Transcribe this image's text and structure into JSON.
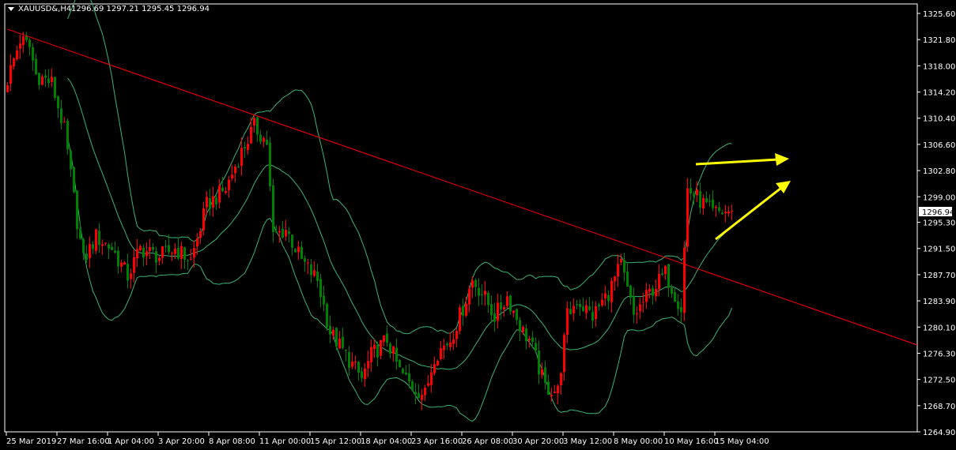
{
  "header": {
    "symbol": "XAUUSD&,H4",
    "ohlc": "1296.69 1297.21 1295.45 1296.94"
  },
  "colors": {
    "background": "#000000",
    "bull_candle": "#ff0000",
    "bear_candle": "#008000",
    "bands": "#3cb371",
    "trendline": "#ff0000",
    "arrows": "#ffff00",
    "axis": "#ffffff"
  },
  "chart_data": {
    "type": "candlestick",
    "title": "XAUUSD&,H4",
    "current_price": "1296.94",
    "ylim": [
      1264.9,
      1325.6
    ],
    "y_ticks": [
      "1325.60",
      "1321.80",
      "1318.00",
      "1314.20",
      "1310.40",
      "1306.60",
      "1302.80",
      "1299.00",
      "1295.30",
      "1291.50",
      "1287.70",
      "1283.90",
      "1280.10",
      "1276.30",
      "1272.50",
      "1268.70",
      "1264.90"
    ],
    "x_ticks": [
      {
        "bar": 0,
        "label": "25 Mar 2019"
      },
      {
        "bar": 16,
        "label": "27 Mar 16:00"
      },
      {
        "bar": 32,
        "label": "1 Apr 04:00"
      },
      {
        "bar": 48,
        "label": "3 Apr 20:00"
      },
      {
        "bar": 64,
        "label": "8 Apr 08:00"
      },
      {
        "bar": 80,
        "label": "11 Apr 00:00"
      },
      {
        "bar": 96,
        "label": "15 Apr 12:00"
      },
      {
        "bar": 112,
        "label": "18 Apr 04:00"
      },
      {
        "bar": 128,
        "label": "23 Apr 16:00"
      },
      {
        "bar": 144,
        "label": "26 Apr 08:00"
      },
      {
        "bar": 160,
        "label": "30 Apr 20:00"
      },
      {
        "bar": 176,
        "label": "3 May 12:00"
      },
      {
        "bar": 192,
        "label": "8 May 00:00"
      },
      {
        "bar": 208,
        "label": "10 May 16:00"
      },
      {
        "bar": 224,
        "label": "15 May 04:00"
      }
    ],
    "total_bars_visible": 288,
    "close_path": [
      [
        0,
        1316.0
      ],
      [
        4,
        1321.8
      ],
      [
        7,
        1320.7
      ],
      [
        9,
        1316.7
      ],
      [
        14,
        1315.5
      ],
      [
        18,
        1308.6
      ],
      [
        22,
        1295.5
      ],
      [
        24,
        1289.7
      ],
      [
        28,
        1293.2
      ],
      [
        33,
        1291.5
      ],
      [
        38,
        1287.5
      ],
      [
        42,
        1291.5
      ],
      [
        48,
        1290.3
      ],
      [
        53,
        1291.5
      ],
      [
        58,
        1289.7
      ],
      [
        63,
        1297.8
      ],
      [
        69,
        1300.1
      ],
      [
        73,
        1304.6
      ],
      [
        78,
        1309.2
      ],
      [
        82,
        1306.9
      ],
      [
        84,
        1293.2
      ],
      [
        88,
        1294.3
      ],
      [
        93,
        1289.7
      ],
      [
        98,
        1286.9
      ],
      [
        102,
        1279.4
      ],
      [
        107,
        1276.0
      ],
      [
        112,
        1272.6
      ],
      [
        115,
        1276.0
      ],
      [
        120,
        1278.3
      ],
      [
        124,
        1273.7
      ],
      [
        128,
        1271.4
      ],
      [
        132,
        1270.3
      ],
      [
        135,
        1276.0
      ],
      [
        140,
        1278.3
      ],
      [
        144,
        1282.9
      ],
      [
        147,
        1286.9
      ],
      [
        150,
        1285.1
      ],
      [
        154,
        1281.7
      ],
      [
        158,
        1284.5
      ],
      [
        163,
        1279.4
      ],
      [
        165,
        1278.3
      ],
      [
        170,
        1271.4
      ],
      [
        174,
        1270.8
      ],
      [
        177,
        1281.7
      ],
      [
        180,
        1284.0
      ],
      [
        185,
        1281.7
      ],
      [
        190,
        1285.1
      ],
      [
        194,
        1289.1
      ],
      [
        198,
        1281.7
      ],
      [
        203,
        1285.1
      ],
      [
        208,
        1287.9
      ],
      [
        213,
        1282.9
      ],
      [
        215,
        1300.1
      ],
      [
        218,
        1298.9
      ],
      [
        223,
        1296.6
      ],
      [
        229,
        1296.94
      ]
    ],
    "bollinger": {
      "period": 20,
      "deviations": 2
    },
    "trendline": {
      "start": [
        0,
        1323.3
      ],
      "end": [
        288,
        1277.5
      ]
    },
    "annotations": [
      "yellow-arrow-horizontal",
      "yellow-arrow-up"
    ]
  }
}
